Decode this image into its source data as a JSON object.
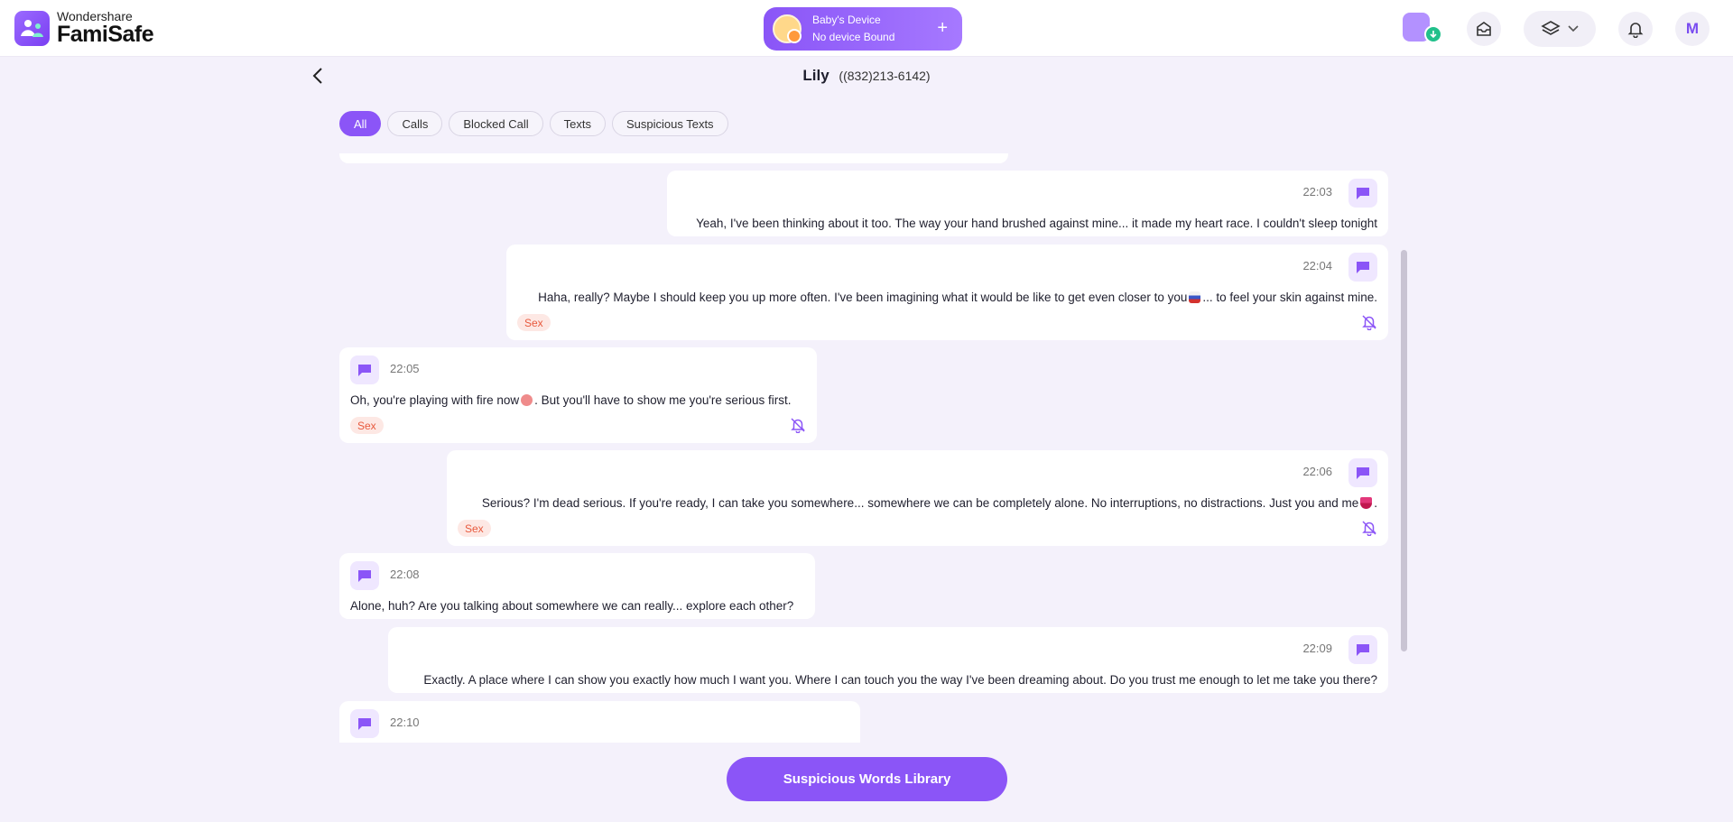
{
  "app": {
    "brand_top": "Wondershare",
    "brand_bottom": "FamiSafe"
  },
  "device": {
    "name": "Baby's Device",
    "status": "No device Bound",
    "add_icon": "plus-icon"
  },
  "header": {
    "avatar_initial": "M",
    "icons": [
      "app-download-icon",
      "inbox-icon",
      "layers-icon",
      "bell-icon"
    ]
  },
  "contact": {
    "name": "Lily",
    "phone": "((832)213-6142)"
  },
  "filters": [
    "All",
    "Calls",
    "Blocked Call",
    "Texts",
    "Suspicious Texts"
  ],
  "active_filter": "All",
  "messages": [
    {
      "side": "right",
      "time": "22:03",
      "text": "Yeah, I've been thinking about it too. The way your hand brushed against mine... it made my heart race. I couldn't sleep tonight",
      "tag": ""
    },
    {
      "side": "right",
      "time": "22:04",
      "text_a": "Haha, really? Maybe I should keep you up more often. I've been imagining what it would be like to get even closer to you",
      "text_b": "... to feel your skin against mine.",
      "tag": "Sex"
    },
    {
      "side": "left",
      "time": "22:05",
      "text_a": "Oh, you're playing with fire now",
      "text_b": ". But you'll have to show me you're serious first.",
      "tag": "Sex"
    },
    {
      "side": "right",
      "time": "22:06",
      "text_a": "Serious? I'm dead serious. If you're ready, I can take you somewhere... somewhere we can be completely alone. No interruptions, no distractions. Just you and me",
      "text_b": ".",
      "tag": "Sex"
    },
    {
      "side": "left",
      "time": "22:08",
      "text": "Alone, huh? Are you talking about somewhere we can really... explore each other?",
      "tag": ""
    },
    {
      "side": "right",
      "time": "22:09",
      "text": "Exactly. A place where I can show you exactly how much I want you. Where I can touch you the way I've been dreaming about. Do you trust me enough to let me take you there?",
      "tag": ""
    },
    {
      "side": "left",
      "time": "22:10",
      "text": "",
      "tag": ""
    }
  ],
  "library_button": "Suspicious Words Library",
  "colors": {
    "accent": "#8b55f7",
    "background": "#f4f1fb",
    "tag_bg": "#fde8e4",
    "tag_text": "#e8593d"
  }
}
